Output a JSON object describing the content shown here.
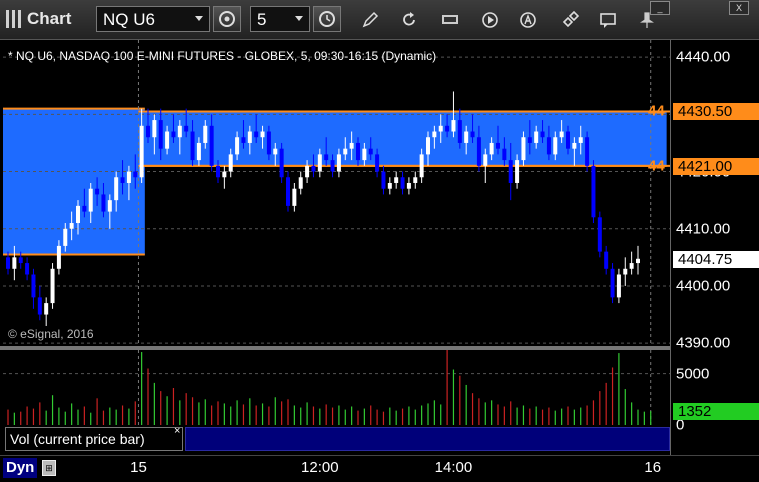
{
  "window": {
    "title": "Chart",
    "symbol": "NQ U6",
    "interval": "5",
    "minimize_label": "_",
    "close_label": "X"
  },
  "chart_data": {
    "type": "candlestick",
    "title": "* NQ U6, NASDAQ 100 E-MINI FUTURES - GLOBEX, 5, 09:30-16:15 (Dynamic)",
    "copyright": "© eSignal, 2016",
    "y_ticks": [
      "4440.00",
      "4430.00",
      "4420.00",
      "4410.00",
      "4400.00",
      "4390.00"
    ],
    "y_tick_values": [
      4440,
      4430,
      4420,
      4410,
      4400,
      4390
    ],
    "ylim": [
      4389.5,
      4443
    ],
    "x_ticks": [
      "15",
      "12:00",
      "14:00",
      "16"
    ],
    "levels": [
      {
        "label": "4430.50",
        "value": 4430.5,
        "short": "44"
      },
      {
        "label": "4421.00",
        "value": 4421.0,
        "short": "44"
      }
    ],
    "zones": [
      {
        "from": 4405.5,
        "to": 4431.0,
        "bars": [
          0,
          21
        ]
      },
      {
        "from": 4421.0,
        "to": 4430.5,
        "bars": [
          21,
          103
        ]
      }
    ],
    "last_price": "4404.75",
    "candles": [
      [
        4405,
        4406,
        4402,
        4403
      ],
      [
        4403,
        4407,
        4401,
        4405
      ],
      [
        4405,
        4406,
        4403,
        4404
      ],
      [
        4404,
        4405,
        4401,
        4402
      ],
      [
        4402,
        4403,
        4396,
        4398
      ],
      [
        4398,
        4400,
        4394,
        4395
      ],
      [
        4395,
        4398,
        4393,
        4397
      ],
      [
        4397,
        4404,
        4396,
        4403
      ],
      [
        4403,
        4408,
        4402,
        4407
      ],
      [
        4407,
        4411,
        4406,
        4410
      ],
      [
        4410,
        4413,
        4408,
        4411
      ],
      [
        4411,
        4415,
        4409,
        4414
      ],
      [
        4414,
        4417,
        4412,
        4413
      ],
      [
        4413,
        4418,
        4411,
        4417
      ],
      [
        4417,
        4419,
        4414,
        4416
      ],
      [
        4416,
        4418,
        4412,
        4413
      ],
      [
        4413,
        4416,
        4410,
        4415
      ],
      [
        4415,
        4420,
        4413,
        4419
      ],
      [
        4419,
        4422,
        4416,
        4418
      ],
      [
        4418,
        4421,
        4415,
        4420
      ],
      [
        4420,
        4423,
        4417,
        4419
      ],
      [
        4419,
        4431,
        4418,
        4428
      ],
      [
        4428,
        4431,
        4425,
        4426
      ],
      [
        4426,
        4430,
        4423,
        4429
      ],
      [
        4429,
        4431,
        4422,
        4424
      ],
      [
        4424,
        4428,
        4423,
        4427
      ],
      [
        4427,
        4430,
        4425,
        4426
      ],
      [
        4426,
        4429,
        4423,
        4428
      ],
      [
        4428,
        4431,
        4426,
        4427
      ],
      [
        4427,
        4429,
        4421,
        4422
      ],
      [
        4422,
        4426,
        4421,
        4425
      ],
      [
        4425,
        4429,
        4424,
        4428
      ],
      [
        4428,
        4430,
        4420,
        4421
      ],
      [
        4421,
        4422,
        4418,
        4419
      ],
      [
        4419,
        4421,
        4417,
        4420
      ],
      [
        4420,
        4424,
        4419,
        4423
      ],
      [
        4423,
        4427,
        4422,
        4426
      ],
      [
        4426,
        4429,
        4424,
        4425
      ],
      [
        4425,
        4428,
        4423,
        4427
      ],
      [
        4427,
        4430,
        4425,
        4426
      ],
      [
        4426,
        4428,
        4424,
        4427
      ],
      [
        4427,
        4428,
        4422,
        4423
      ],
      [
        4423,
        4425,
        4421,
        4424
      ],
      [
        4424,
        4425,
        4418,
        4419
      ],
      [
        4419,
        4420,
        4413,
        4414
      ],
      [
        4414,
        4418,
        4413,
        4417
      ],
      [
        4417,
        4420,
        4416,
        4419
      ],
      [
        4419,
        4422,
        4418,
        4421
      ],
      [
        4421,
        4423,
        4419,
        4420
      ],
      [
        4420,
        4424,
        4419,
        4423
      ],
      [
        4423,
        4426,
        4421,
        4422
      ],
      [
        4422,
        4423,
        4419,
        4420
      ],
      [
        4420,
        4424,
        4419,
        4423
      ],
      [
        4423,
        4426,
        4422,
        4424
      ],
      [
        4424,
        4427,
        4422,
        4425
      ],
      [
        4425,
        4426,
        4421,
        4422
      ],
      [
        4422,
        4425,
        4421,
        4424
      ],
      [
        4424,
        4426,
        4422,
        4423
      ],
      [
        4423,
        4424,
        4419,
        4420
      ],
      [
        4420,
        4421,
        4416,
        4417
      ],
      [
        4417,
        4419,
        4416,
        4418
      ],
      [
        4418,
        4420,
        4417,
        4419
      ],
      [
        4419,
        4420,
        4416,
        4417
      ],
      [
        4417,
        4419,
        4416,
        4418
      ],
      [
        4418,
        4420,
        4417,
        4419
      ],
      [
        4419,
        4424,
        4418,
        4423
      ],
      [
        4423,
        4427,
        4421,
        4426
      ],
      [
        4426,
        4428,
        4424,
        4427
      ],
      [
        4427,
        4430,
        4425,
        4428
      ],
      [
        4428,
        4430,
        4426,
        4427
      ],
      [
        4427,
        4434,
        4426,
        4429
      ],
      [
        4429,
        4431,
        4424,
        4425
      ],
      [
        4425,
        4428,
        4423,
        4427
      ],
      [
        4427,
        4430,
        4425,
        4426
      ],
      [
        4426,
        4428,
        4420,
        4421
      ],
      [
        4421,
        4424,
        4418,
        4423
      ],
      [
        4423,
        4426,
        4422,
        4425
      ],
      [
        4425,
        4428,
        4423,
        4424
      ],
      [
        4424,
        4426,
        4421,
        4422
      ],
      [
        4422,
        4425,
        4415,
        4418
      ],
      [
        4418,
        4423,
        4417,
        4422
      ],
      [
        4422,
        4427,
        4421,
        4426
      ],
      [
        4426,
        4429,
        4423,
        4425
      ],
      [
        4425,
        4428,
        4424,
        4427
      ],
      [
        4427,
        4429,
        4425,
        4426
      ],
      [
        4426,
        4428,
        4422,
        4423
      ],
      [
        4423,
        4427,
        4422,
        4426
      ],
      [
        4426,
        4429,
        4425,
        4427
      ],
      [
        4427,
        4428,
        4423,
        4424
      ],
      [
        4424,
        4426,
        4421,
        4425
      ],
      [
        4425,
        4428,
        4423,
        4426
      ],
      [
        4426,
        4427,
        4420,
        4421
      ],
      [
        4421,
        4422,
        4411,
        4412
      ],
      [
        4412,
        4413,
        4405,
        4406
      ],
      [
        4406,
        4407,
        4402,
        4403
      ],
      [
        4403,
        4404,
        4397,
        4398
      ],
      [
        4398,
        4403,
        4397,
        4402
      ],
      [
        4402,
        4405,
        4400,
        4403
      ],
      [
        4403,
        4406,
        4402,
        4404
      ],
      [
        4404,
        4407,
        4402,
        4404.75
      ]
    ],
    "volume": {
      "label": "Vol (current price bar)",
      "close_label": "×",
      "y_ticks": [
        "5000",
        "0"
      ],
      "y_tick_values": [
        5000,
        0
      ],
      "ylim": [
        0,
        7300
      ],
      "current": "1352",
      "values": [
        1500,
        1200,
        1300,
        1800,
        1600,
        2200,
        1400,
        2900,
        1700,
        1300,
        2100,
        1500,
        1800,
        1200,
        2600,
        1400,
        1700,
        1500,
        1900,
        1600,
        2300,
        7100,
        5500,
        4100,
        3300,
        2800,
        3600,
        2400,
        3100,
        2700,
        2200,
        2500,
        1900,
        2300,
        2100,
        1800,
        2400,
        2000,
        2600,
        1900,
        2100,
        1800,
        2700,
        2300,
        2500,
        1900,
        1700,
        2200,
        1800,
        1600,
        2000,
        1700,
        1900,
        1500,
        1800,
        1400,
        1600,
        1900,
        1500,
        1300,
        1700,
        1400,
        1600,
        1800,
        1500,
        1900,
        2100,
        2400,
        2000,
        7400,
        5400,
        4800,
        3900,
        3100,
        2600,
        2200,
        2400,
        2000,
        1800,
        2300,
        1700,
        1900,
        1600,
        1800,
        1500,
        1700,
        1400,
        1600,
        1800,
        1500,
        1700,
        1900,
        2400,
        3300,
        4100,
        5600,
        7000,
        3500,
        2200,
        1500,
        1300,
        1352
      ]
    },
    "colors": {
      "up": "#ffffff",
      "down": "#0000ff",
      "zone": "#1e6bff",
      "level_line": "#ff8c1a",
      "vol_up": "#33cc33",
      "vol_down": "#cc2222",
      "last_price_bg": "#ffffff",
      "vol_current_bg": "#22cc22"
    }
  },
  "toolbar": {
    "icons": [
      "settings-icon",
      "clock-icon",
      "pencil-icon",
      "refresh-icon",
      "get-icon",
      "play-icon",
      "alert-icon",
      "link-icon",
      "chat-icon",
      "pin-icon"
    ]
  },
  "status": {
    "mode": "Dyn"
  }
}
